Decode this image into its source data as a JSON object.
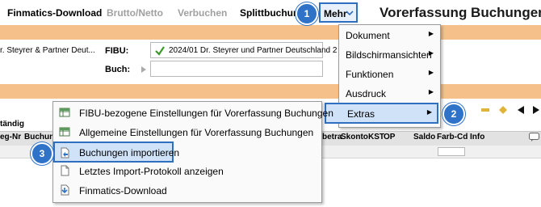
{
  "toolbar": {
    "finmatics_download": "Finmatics-Download",
    "brutto_netto": "Brutto/Netto",
    "verbuchen": "Verbuchen",
    "splittbuchung": "Splittbuchung",
    "mehr": "Mehr",
    "page_title": "Vorerfassung Buchungen"
  },
  "form": {
    "company_truncated": "r. Steyrer & Partner Deut...",
    "fibu_label": "FIBU:",
    "fibu_value": "2024/01 Dr. Steyrer und Partner Deutschland 2",
    "buch_label": "Buch:",
    "buch_value": ""
  },
  "grid": {
    "tab_label": "tändig",
    "columns": [
      "eg-Nr",
      "Buchung",
      "betra",
      "Skonto",
      "KST",
      "OP",
      "Saldo",
      "Farb-Cd",
      "Info"
    ]
  },
  "mehr_menu": {
    "items": [
      {
        "label": "Dokument",
        "underline_char": "D",
        "has_submenu": true
      },
      {
        "label": "Bildschirmansichten",
        "underline_char": "B",
        "has_submenu": true
      },
      {
        "label": "Funktionen",
        "underline_char": "F",
        "has_submenu": true
      },
      {
        "label": "Ausdruck",
        "underline_char": "A",
        "has_submenu": true
      },
      {
        "label": "Extras",
        "underline_char": "E",
        "has_submenu": true,
        "highlighted": true
      }
    ]
  },
  "extras_menu": {
    "items": [
      {
        "label": "FIBU-bezogene Einstellungen für Vorerfassung Buchungen",
        "icon": "settings-grid-icon"
      },
      {
        "label": "Allgemeine Einstellungen für Vorerfassung Buchungen",
        "icon": "settings-grid-icon"
      },
      {
        "label": "Buchungen importieren",
        "icon": "import-document-icon",
        "highlighted": true
      },
      {
        "label": "Letztes Import-Protokoll anzeigen",
        "icon": "blank-document-icon"
      },
      {
        "label": "Finmatics-Download",
        "icon": "download-arrow-icon"
      }
    ]
  },
  "callouts": {
    "one": "1",
    "two": "2",
    "three": "3"
  },
  "colors": {
    "accent_blue": "#2f6fbf",
    "callout_blue": "#2f73c9",
    "orange_band": "#f5c089",
    "check_green": "#3a9a2a"
  }
}
